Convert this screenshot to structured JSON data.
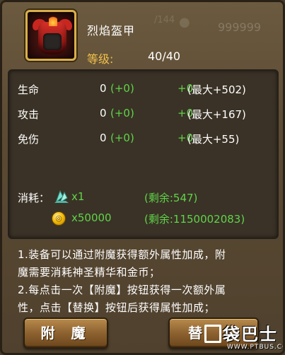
{
  "item": {
    "name": "烈焰盔甲",
    "level_label": "等级:",
    "level_value": "40/40"
  },
  "stats": [
    {
      "name": "生命",
      "value": "0",
      "bonus": "(+0)",
      "plus": "+0",
      "max": "(最大+502)"
    },
    {
      "name": "攻击",
      "value": "0",
      "bonus": "(+0)",
      "plus": "+0",
      "max": "(最大+167)"
    },
    {
      "name": "免伤",
      "value": "0",
      "bonus": "(+0)",
      "plus": "+0",
      "max": "(最大+55)"
    }
  ],
  "cost": {
    "label": "消耗：",
    "crystal_amount": "x1",
    "crystal_remaining": "(剩余:547)",
    "coin_amount": "x50000",
    "coin_remaining": "(剩余:1150002083)"
  },
  "description": [
    "1.装备可以通过附魔获得额外属性加成，附",
    "魔需要消耗神圣精华和金币；",
    "2.每点击一次【附魔】按钮获得一次额外属",
    "性，点击【替换】按钮后获得属性加成；"
  ],
  "buttons": {
    "enchant": "附 魔",
    "replace": "替"
  },
  "watermark": {
    "text": "袋巴士",
    "url": "WWW.PTBUS.COM"
  },
  "colors": {
    "gold": "#f2c04a",
    "green": "#5fd44a",
    "panel": "#3a3226"
  }
}
